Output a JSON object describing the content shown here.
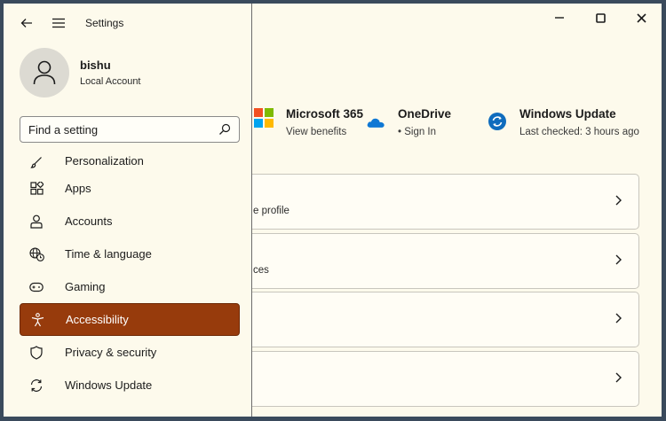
{
  "app": {
    "title": "Settings"
  },
  "profile": {
    "name": "bishu",
    "account_type": "Local Account"
  },
  "search": {
    "placeholder": "Find a setting"
  },
  "menu": [
    {
      "label": "Personalization",
      "icon": "brush-icon"
    },
    {
      "label": "Apps",
      "icon": "apps-icon"
    },
    {
      "label": "Accounts",
      "icon": "person-icon"
    },
    {
      "label": "Time & language",
      "icon": "globe-clock-icon"
    },
    {
      "label": "Gaming",
      "icon": "gamepad-icon"
    },
    {
      "label": "Accessibility",
      "icon": "accessibility-icon",
      "active": true
    },
    {
      "label": "Privacy & security",
      "icon": "shield-icon"
    },
    {
      "label": "Windows Update",
      "icon": "update-icon"
    }
  ],
  "tiles": [
    {
      "title": "Microsoft 365",
      "subtitle": "View benefits",
      "icon": "microsoft-logo-icon"
    },
    {
      "title": "OneDrive",
      "subtitle": "• Sign In",
      "icon": "cloud-icon"
    },
    {
      "title": "Windows Update",
      "subtitle": "Last checked: 3 hours ago",
      "icon": "refresh-icon"
    }
  ],
  "cards": [
    {
      "text": "e profile"
    },
    {
      "text": "ces"
    },
    {
      "text": ""
    },
    {
      "text": ""
    }
  ],
  "colors": {
    "accent": "#973b0c",
    "background": "#fdfaec",
    "microsoft_blue": "#0f6cbd"
  }
}
